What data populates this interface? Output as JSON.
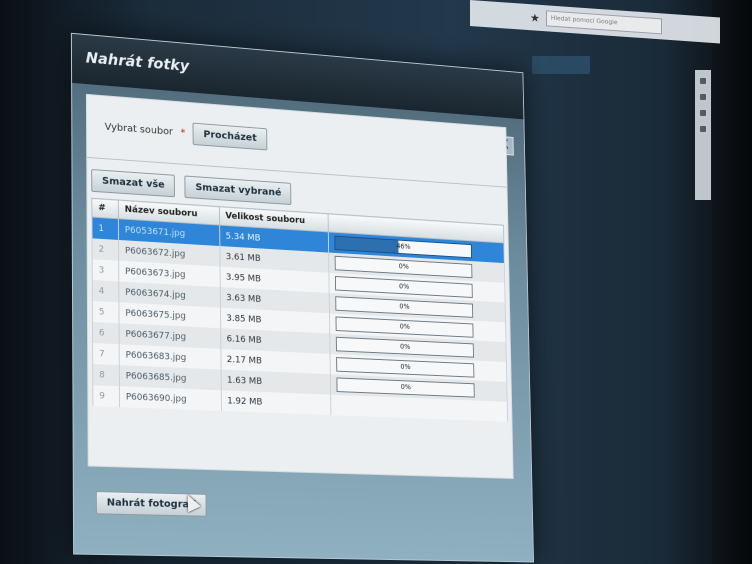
{
  "browser": {
    "search_placeholder": "Hledat pomocí Google"
  },
  "dialog": {
    "title": "Nahrát fotky",
    "close_label": "X",
    "select_label": "Vybrat soubor",
    "required_mark": "*",
    "browse_button": "Procházet",
    "delete_all_button": "Smazat vše",
    "delete_selected_button": "Smazat vybrané",
    "upload_button": "Nahrát fotografi"
  },
  "table": {
    "columns": [
      "#",
      "Název souboru",
      "Velikost souboru",
      ""
    ],
    "rows": [
      {
        "num": "1",
        "name": "P6053671.jpg",
        "size": "5.34 MB",
        "progress_label": "46%",
        "progress": 46,
        "selected": true
      },
      {
        "num": "2",
        "name": "P6063672.jpg",
        "size": "3.61 MB",
        "progress_label": "0%",
        "progress": 0
      },
      {
        "num": "3",
        "name": "P6063673.jpg",
        "size": "3.95 MB",
        "progress_label": "0%",
        "progress": 0
      },
      {
        "num": "4",
        "name": "P6063674.jpg",
        "size": "3.63 MB",
        "progress_label": "0%",
        "progress": 0
      },
      {
        "num": "5",
        "name": "P6063675.jpg",
        "size": "3.85 MB",
        "progress_label": "0%",
        "progress": 0
      },
      {
        "num": "6",
        "name": "P6063677.jpg",
        "size": "6.16 MB",
        "progress_label": "0%",
        "progress": 0
      },
      {
        "num": "7",
        "name": "P6063683.jpg",
        "size": "2.17 MB",
        "progress_label": "0%",
        "progress": 0
      },
      {
        "num": "8",
        "name": "P6063685.jpg",
        "size": "1.63 MB",
        "progress_label": "0%",
        "progress": 0
      },
      {
        "num": "9",
        "name": "P6063690.jpg",
        "size": "1.92 MB",
        "progress_label": ""
      }
    ]
  },
  "colors": {
    "selected_row": "#2f86d8",
    "progress_fill": "#2e6fb0",
    "required": "#c01818"
  },
  "icons": {
    "close": "close-icon",
    "cursor": "mouse-cursor-icon"
  }
}
